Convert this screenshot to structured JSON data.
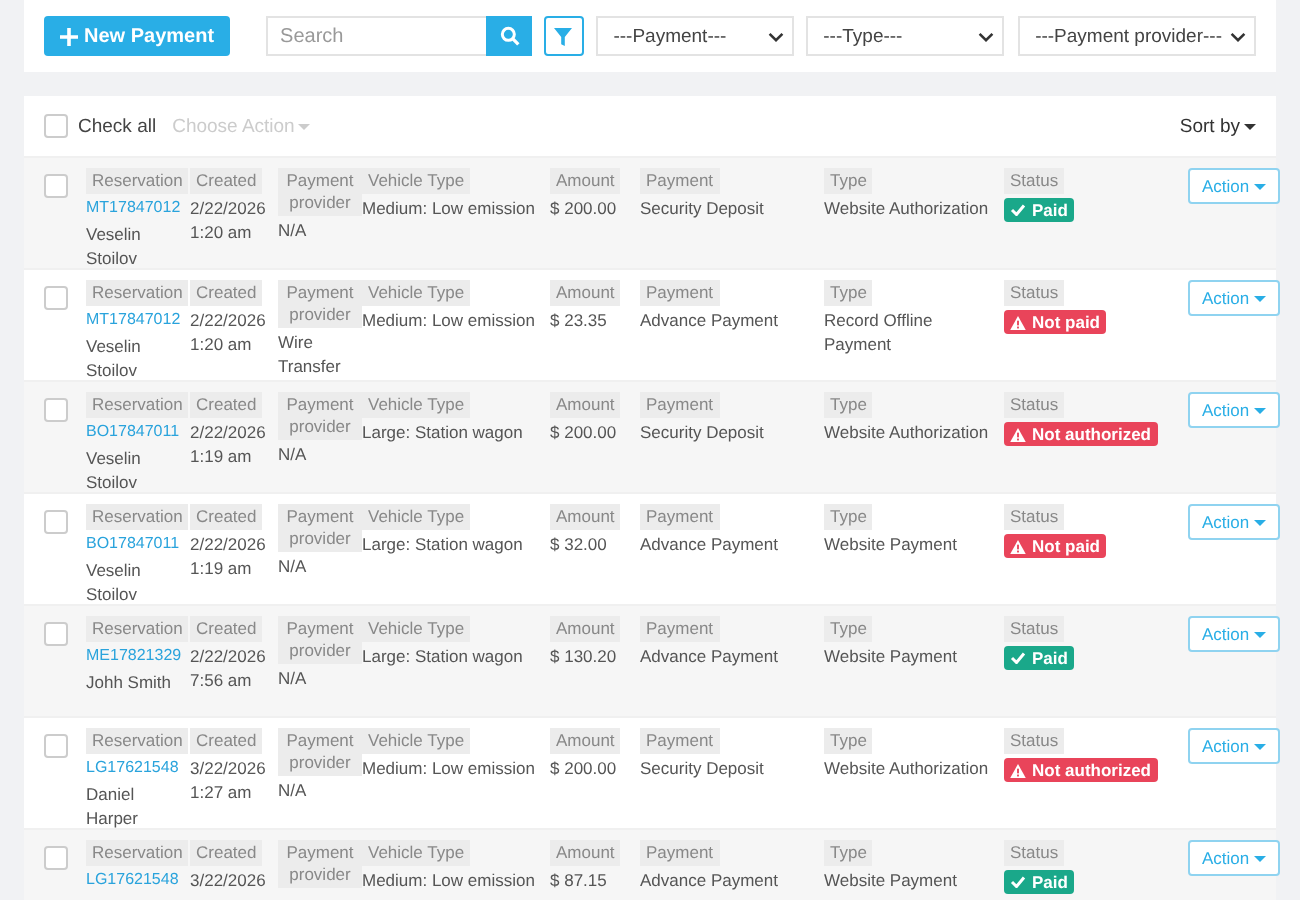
{
  "toolbar": {
    "new_button": "New Payment",
    "search": {
      "placeholder": "Search"
    },
    "selects": [
      "---Payment---",
      "---Type---",
      "---Payment provider---"
    ]
  },
  "list_header": {
    "check_all": {
      "label": "Check all",
      "checked": false
    },
    "choose_action": {
      "label": "Choose Action",
      "disabled": true
    },
    "sort_by": "Sort by"
  },
  "rows": [
    {
      "checked": false,
      "reservation": {
        "label": "Reservation",
        "code": "MT17847012",
        "name": "Veselin Stoilov"
      },
      "created": {
        "label": "Created",
        "value": "2/22/2026 1:20 am"
      },
      "provider": {
        "label": "Payment provider",
        "value": "N/A"
      },
      "vehicle": {
        "label": "Vehicle Type",
        "value": "Medium: Low emission"
      },
      "amount": {
        "label": "Amount",
        "value": "$ 200.00"
      },
      "payment": {
        "label": "Payment",
        "value": "Security Deposit"
      },
      "type": {
        "label": "Type",
        "value": "Website Authorization"
      },
      "status": {
        "label": "Status",
        "kind": "paid",
        "text": "Paid"
      },
      "action": "Action"
    },
    {
      "checked": false,
      "reservation": {
        "label": "Reservation",
        "code": "MT17847012",
        "name": "Veselin Stoilov"
      },
      "created": {
        "label": "Created",
        "value": "2/22/2026 1:20 am"
      },
      "provider": {
        "label": "Payment provider",
        "value": "Wire Transfer"
      },
      "vehicle": {
        "label": "Vehicle Type",
        "value": "Medium: Low emission"
      },
      "amount": {
        "label": "Amount",
        "value": "$ 23.35"
      },
      "payment": {
        "label": "Payment",
        "value": "Advance Payment"
      },
      "type": {
        "label": "Type",
        "value": "Record Offline Payment"
      },
      "status": {
        "label": "Status",
        "kind": "not_paid",
        "text": "Not paid"
      },
      "action": "Action"
    },
    {
      "checked": false,
      "reservation": {
        "label": "Reservation",
        "code": "BO17847011",
        "name": "Veselin Stoilov"
      },
      "created": {
        "label": "Created",
        "value": "2/22/2026 1:19 am"
      },
      "provider": {
        "label": "Payment provider",
        "value": "N/A"
      },
      "vehicle": {
        "label": "Vehicle Type",
        "value": "Large: Station wagon"
      },
      "amount": {
        "label": "Amount",
        "value": "$ 200.00"
      },
      "payment": {
        "label": "Payment",
        "value": "Security Deposit"
      },
      "type": {
        "label": "Type",
        "value": "Website Authorization"
      },
      "status": {
        "label": "Status",
        "kind": "not_authorized",
        "text": "Not authorized"
      },
      "action": "Action"
    },
    {
      "checked": false,
      "reservation": {
        "label": "Reservation",
        "code": "BO17847011",
        "name": "Veselin Stoilov"
      },
      "created": {
        "label": "Created",
        "value": "2/22/2026 1:19 am"
      },
      "provider": {
        "label": "Payment provider",
        "value": "N/A"
      },
      "vehicle": {
        "label": "Vehicle Type",
        "value": "Large: Station wagon"
      },
      "amount": {
        "label": "Amount",
        "value": "$ 32.00"
      },
      "payment": {
        "label": "Payment",
        "value": "Advance Payment"
      },
      "type": {
        "label": "Type",
        "value": "Website Payment"
      },
      "status": {
        "label": "Status",
        "kind": "not_paid",
        "text": "Not paid"
      },
      "action": "Action"
    },
    {
      "checked": false,
      "reservation": {
        "label": "Reservation",
        "code": "ME17821329",
        "name": "Johh Smith"
      },
      "created": {
        "label": "Created",
        "value": "2/22/2026 7:56 am"
      },
      "provider": {
        "label": "Payment provider",
        "value": "N/A"
      },
      "vehicle": {
        "label": "Vehicle Type",
        "value": "Large: Station wagon"
      },
      "amount": {
        "label": "Amount",
        "value": "$ 130.20"
      },
      "payment": {
        "label": "Payment",
        "value": "Advance Payment"
      },
      "type": {
        "label": "Type",
        "value": "Website Payment"
      },
      "status": {
        "label": "Status",
        "kind": "paid",
        "text": "Paid"
      },
      "action": "Action"
    },
    {
      "checked": false,
      "reservation": {
        "label": "Reservation",
        "code": "LG17621548",
        "name": "Daniel Harper"
      },
      "created": {
        "label": "Created",
        "value": "3/22/2026 1:27 am"
      },
      "provider": {
        "label": "Payment provider",
        "value": "N/A"
      },
      "vehicle": {
        "label": "Vehicle Type",
        "value": "Medium: Low emission"
      },
      "amount": {
        "label": "Amount",
        "value": "$ 200.00"
      },
      "payment": {
        "label": "Payment",
        "value": "Security Deposit"
      },
      "type": {
        "label": "Type",
        "value": "Website Authorization"
      },
      "status": {
        "label": "Status",
        "kind": "not_authorized",
        "text": "Not authorized"
      },
      "action": "Action"
    },
    {
      "checked": false,
      "reservation": {
        "label": "Reservation",
        "code": "LG17621548"
      },
      "created": {
        "label": "Created",
        "value": "3/22/2026"
      },
      "provider": {
        "label": "Payment provider"
      },
      "vehicle": {
        "label": "Vehicle Type",
        "value": "Medium: Low emission"
      },
      "amount": {
        "label": "Amount",
        "value": "$ 87.15"
      },
      "payment": {
        "label": "Payment",
        "value": "Advance Payment"
      },
      "type": {
        "label": "Type",
        "value": "Website Payment"
      },
      "status": {
        "label": "Status",
        "kind": "paid",
        "text": "Paid"
      },
      "action": "Action"
    }
  ]
}
